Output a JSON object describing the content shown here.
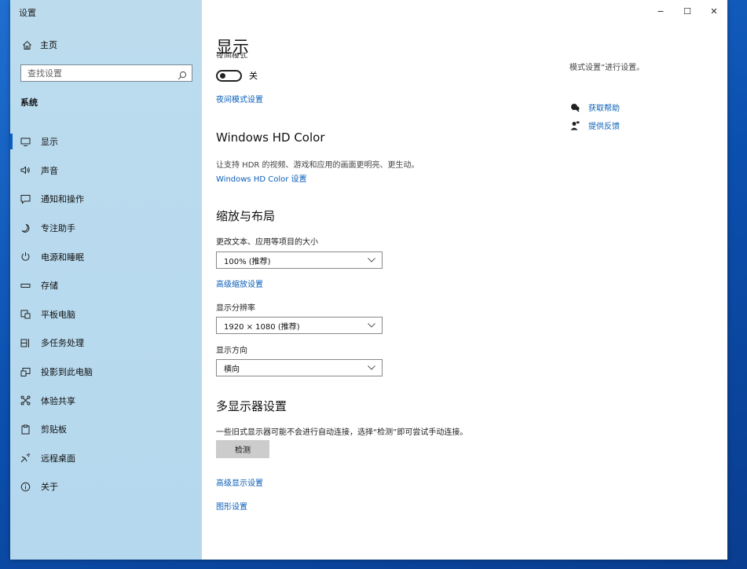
{
  "app": {
    "title": "设置"
  },
  "window_controls": {
    "minimize": "−",
    "maximize": "☐",
    "close": "✕"
  },
  "sidebar": {
    "home_label": "主页",
    "search_placeholder": "查找设置",
    "section_title": "系统",
    "items": [
      {
        "label": "显示",
        "icon": "monitor-icon",
        "active": true
      },
      {
        "label": "声音",
        "icon": "speaker-icon"
      },
      {
        "label": "通知和操作",
        "icon": "notification-icon"
      },
      {
        "label": "专注助手",
        "icon": "moon-icon"
      },
      {
        "label": "电源和睡眠",
        "icon": "power-icon"
      },
      {
        "label": "存储",
        "icon": "storage-icon"
      },
      {
        "label": "平板电脑",
        "icon": "tablet-icon"
      },
      {
        "label": "多任务处理",
        "icon": "multitask-icon"
      },
      {
        "label": "投影到此电脑",
        "icon": "project-icon"
      },
      {
        "label": "体验共享",
        "icon": "share-icon"
      },
      {
        "label": "剪贴板",
        "icon": "clipboard-icon"
      },
      {
        "label": "远程桌面",
        "icon": "remote-desktop-icon"
      },
      {
        "label": "关于",
        "icon": "info-icon"
      }
    ]
  },
  "main": {
    "title": "显示",
    "night_light": {
      "label": "夜间模式",
      "toggle_state": "关",
      "settings_link": "夜间模式设置"
    },
    "hdr": {
      "heading": "Windows HD Color",
      "description": "让支持 HDR 的视频、游戏和应用的画面更明亮、更生动。",
      "link": "Windows HD Color 设置"
    },
    "scale": {
      "heading": "缩放与布局",
      "size_label": "更改文本、应用等项目的大小",
      "size_value": "100% (推荐)",
      "advanced_link": "高级缩放设置",
      "resolution_label": "显示分辨率",
      "resolution_value": "1920 × 1080 (推荐)",
      "orientation_label": "显示方向",
      "orientation_value": "横向"
    },
    "multi": {
      "heading": "多显示器设置",
      "description": "一些旧式显示器可能不会进行自动连接，选择“检测”即可尝试手动连接。",
      "detect_button": "检测",
      "advanced_display_link": "高级显示设置",
      "graphics_link": "图形设置"
    },
    "right_panel": {
      "note": "模式设置”进行设置。",
      "get_help": "获取帮助",
      "feedback": "提供反馈"
    }
  }
}
